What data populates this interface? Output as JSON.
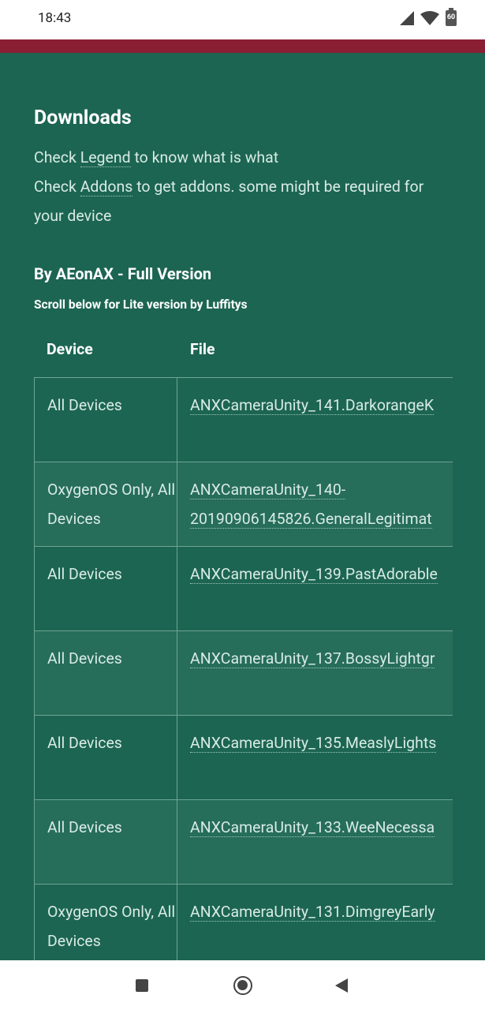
{
  "status_bar": {
    "time": "18:43",
    "battery": "60"
  },
  "page": {
    "heading": "Downloads",
    "intro_line1_pre": "Check ",
    "intro_line1_link": "Legend",
    "intro_line1_post": " to know what is what",
    "intro_line2_pre": "Check ",
    "intro_line2_link": "Addons",
    "intro_line2_post": " to get addons. some might be required for your device",
    "section_title": "By AEonAX - Full Version",
    "scroll_note": "Scroll below for Lite version by Luffitys"
  },
  "table": {
    "headers": {
      "device": "Device",
      "file": "File"
    },
    "rows": [
      {
        "device": "All Devices",
        "file": "ANXCameraUnity_141.DarkorangeK"
      },
      {
        "device": "OxygenOS Only, All Devices",
        "file_line1": "ANXCameraUnity_140-",
        "file_line2": "20190906145826.GeneralLegitimat"
      },
      {
        "device": "All Devices",
        "file": "ANXCameraUnity_139.PastAdorable"
      },
      {
        "device": "All Devices",
        "file": "ANXCameraUnity_137.BossyLightgr"
      },
      {
        "device": "All Devices",
        "file": "ANXCameraUnity_135.MeaslyLights"
      },
      {
        "device": "All Devices",
        "file": "ANXCameraUnity_133.WeeNecessa"
      },
      {
        "device": "OxygenOS Only, All Devices",
        "file": "ANXCameraUnity_131.DimgreyEarly"
      }
    ]
  },
  "icons": {
    "signal": "cell-signal-icon",
    "wifi": "wifi-icon",
    "battery": "battery-icon",
    "nav_recents": "recents-square-icon",
    "nav_home": "home-circle-icon",
    "nav_back": "back-triangle-icon"
  },
  "colors": {
    "page_bg": "#1c6552",
    "header_accent": "#8a1e33",
    "row_alt": "#266d5a"
  }
}
